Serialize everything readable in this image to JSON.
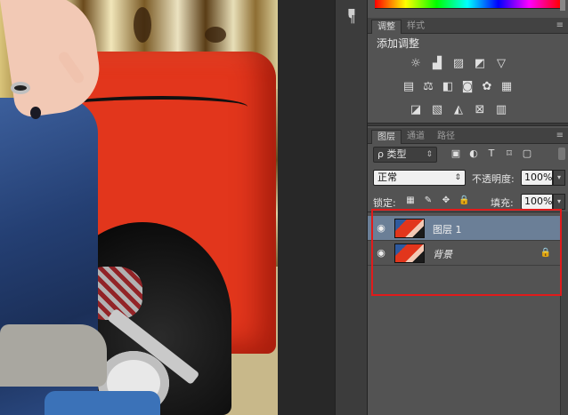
{
  "collapsed_column": {
    "paragraph_icon": "¶"
  },
  "adjustments_panel": {
    "tabs": [
      {
        "label": "调整",
        "active": true
      },
      {
        "label": "样式",
        "active": false
      }
    ],
    "menu_icon": "≡",
    "title": "添加调整",
    "icons_row1": [
      "brightness-contrast-icon",
      "levels-icon",
      "curves-icon",
      "exposure-icon",
      "vibrance-icon"
    ],
    "icons_row2": [
      "hue-saturation-icon",
      "color-balance-icon",
      "black-white-icon",
      "photo-filter-icon",
      "channel-mixer-icon",
      "color-lookup-icon"
    ],
    "icons_row3": [
      "invert-icon",
      "posterize-icon",
      "threshold-icon",
      "selective-color-icon",
      "gradient-map-icon"
    ]
  },
  "layers_panel": {
    "tabs": [
      {
        "label": "图层",
        "active": true
      },
      {
        "label": "通道",
        "active": false
      },
      {
        "label": "路径",
        "active": false
      }
    ],
    "menu_icon": "≡",
    "filter": {
      "label": "ρ 类型",
      "arrow": "⇕"
    },
    "blend_mode": {
      "value": "正常",
      "arrow": "⇕"
    },
    "opacity": {
      "label": "不透明度:",
      "value": "100%"
    },
    "lock": {
      "label": "锁定:"
    },
    "fill": {
      "label": "填充:",
      "value": "100%"
    },
    "layers": [
      {
        "name": "图层 1",
        "visible": true,
        "selected": true,
        "italic": false,
        "locked": false
      },
      {
        "name": "背景",
        "visible": true,
        "selected": false,
        "italic": true,
        "locked": true
      }
    ],
    "icons": {
      "eye": "👁",
      "lock": "🔒",
      "drop": "▾"
    }
  },
  "highlight_color": "#e01b1b",
  "selected_layer_color": "#6b7f97"
}
